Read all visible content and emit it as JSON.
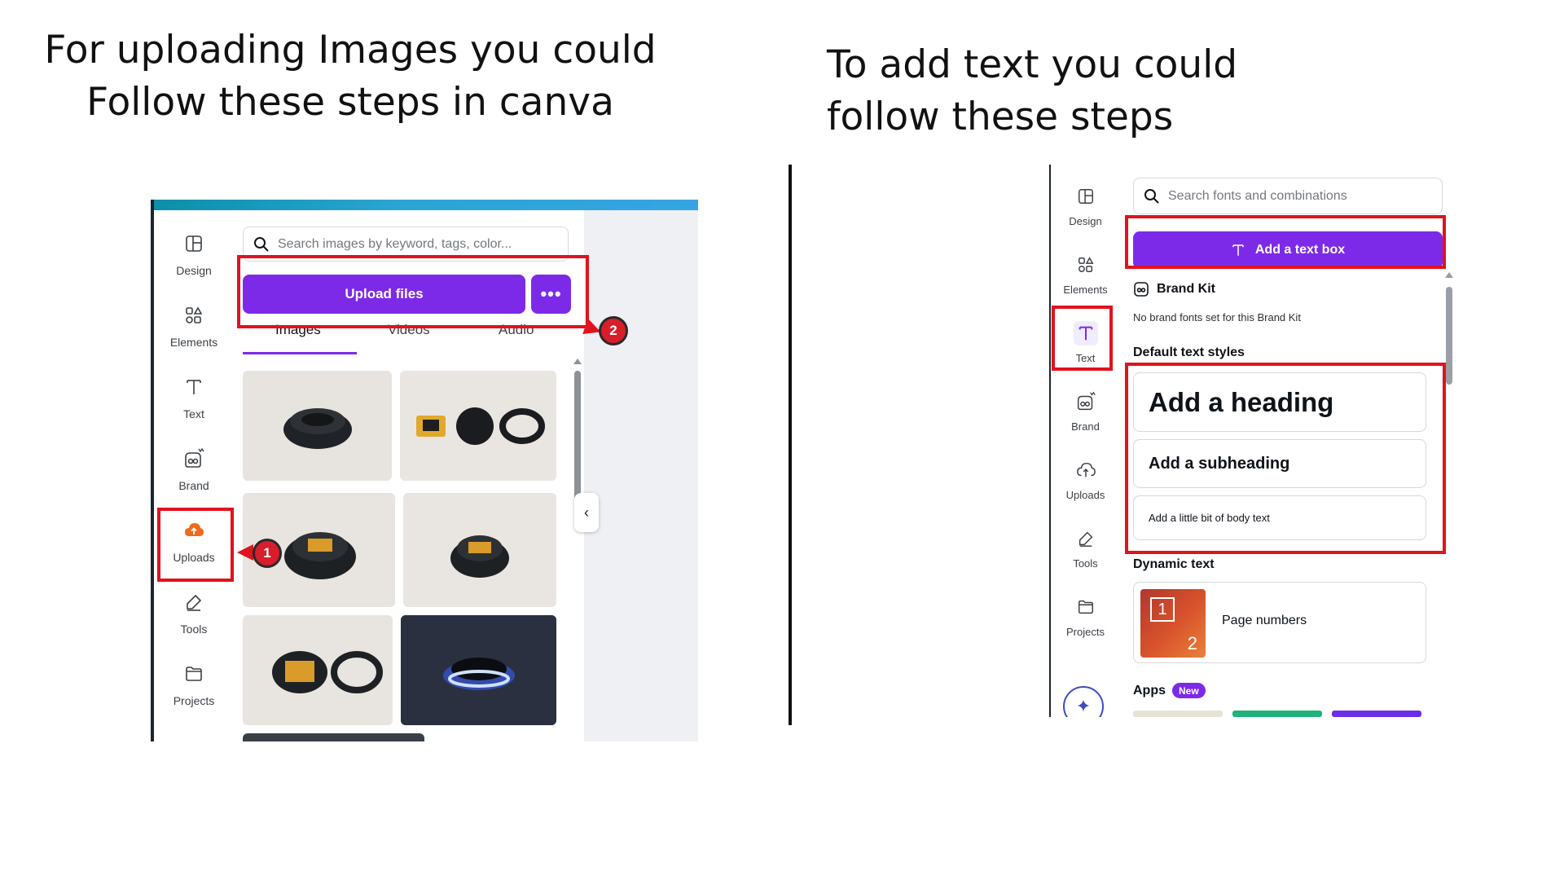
{
  "left_heading": [
    "For uploading Images you could",
    "Follow these steps in canva"
  ],
  "right_heading": [
    "To add text you could",
    "follow these steps"
  ],
  "left_shot": {
    "rail": [
      {
        "label": "Design",
        "icon": "layout-icon"
      },
      {
        "label": "Elements",
        "icon": "shapes-icon"
      },
      {
        "label": "Text",
        "icon": "text-t-icon"
      },
      {
        "label": "Brand",
        "icon": "brand-icon"
      },
      {
        "label": "Uploads",
        "icon": "upload-cloud-icon"
      },
      {
        "label": "Tools",
        "icon": "pen-tool-icon"
      },
      {
        "label": "Projects",
        "icon": "folder-icon"
      }
    ],
    "search_placeholder": "Search images by keyword, tags, color...",
    "upload_button": "Upload files",
    "more_button": "•••",
    "tabs": [
      "Images",
      "Videos",
      "Audio"
    ],
    "active_tab": "Images",
    "badges": [
      "1",
      "2"
    ],
    "collapse_glyph": "‹",
    "accent": "#7d2ae8",
    "highlight": "#e0131e"
  },
  "right_shot": {
    "rail": [
      {
        "label": "Design",
        "icon": "layout-icon"
      },
      {
        "label": "Elements",
        "icon": "shapes-icon"
      },
      {
        "label": "Text",
        "icon": "text-t-icon"
      },
      {
        "label": "Brand",
        "icon": "brand-icon"
      },
      {
        "label": "Uploads",
        "icon": "upload-cloud-icon"
      },
      {
        "label": "Tools",
        "icon": "pen-tool-icon"
      },
      {
        "label": "Projects",
        "icon": "folder-icon"
      }
    ],
    "search_placeholder": "Search fonts and combinations",
    "add_textbox_button": "Add a text box",
    "brand_kit_title": "Brand Kit",
    "brand_kit_note": "No brand fonts set for this Brand Kit",
    "default_styles_title": "Default text styles",
    "styles": [
      "Add a heading",
      "Add a subheading",
      "Add a little bit of body text"
    ],
    "dynamic_text_title": "Dynamic text",
    "page_numbers_label": "Page numbers",
    "page_numbers_digits": [
      "1",
      "2"
    ],
    "apps_title": "Apps",
    "new_badge": "New"
  }
}
